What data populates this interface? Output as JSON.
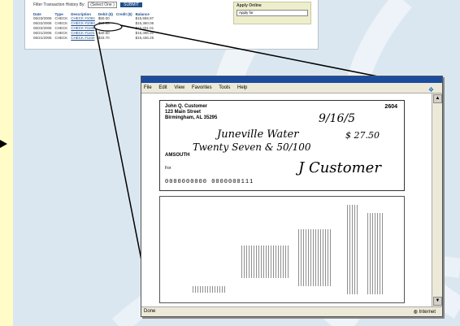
{
  "filter": {
    "label": "Filter Transaction History By:",
    "select_value": "(Select One )",
    "button": "SUBMIT"
  },
  "table": {
    "headers": [
      "Date",
      "Type",
      "Description",
      "Debit ($)",
      "Credit ($)",
      "Balance"
    ],
    "rows": [
      [
        "06/23/2006",
        "CHECK",
        "CHECK #1084",
        "$50.00",
        "",
        "$15,555.97"
      ],
      [
        "06/22/2006",
        "CHECK",
        "CHECK #1083",
        "$53.85",
        "",
        "$15,360.06"
      ],
      [
        "06/22/2006",
        "CHECK",
        "CHECK #1105",
        "",
        "",
        "$15,331.01"
      ],
      [
        "06/21/2006",
        "CHECK",
        "CHECK #1101",
        "$30.60",
        "",
        "$15,496.20"
      ],
      [
        "06/21/2006",
        "CHECK",
        "CHECK #1100",
        "$33.70",
        "",
        "$15,436.25"
      ]
    ]
  },
  "apply": {
    "title": "Apply Online",
    "select_value": "Apply for"
  },
  "browser": {
    "menu": [
      "File",
      "Edit",
      "View",
      "Favorites",
      "Tools",
      "Help"
    ],
    "status_left": "Done",
    "status_right": "Internet"
  },
  "check": {
    "payer_name": "John Q. Customer",
    "payer_street": "123 Main Street",
    "payer_city": "Birmingham, AL 35295",
    "number": "2604",
    "date": "9/16/5",
    "payee": "Juneville Water",
    "amount": "$ 27.50",
    "amount_words": "Twenty Seven & 50/100",
    "bank": "AMSOUTH",
    "memo": "For",
    "micr": "0000000000 0000000111",
    "signature": "J Customer"
  },
  "colors": {
    "accent": "#1d4f8a",
    "background": "#dbe7f0",
    "left_strip": "#fffcc8"
  }
}
